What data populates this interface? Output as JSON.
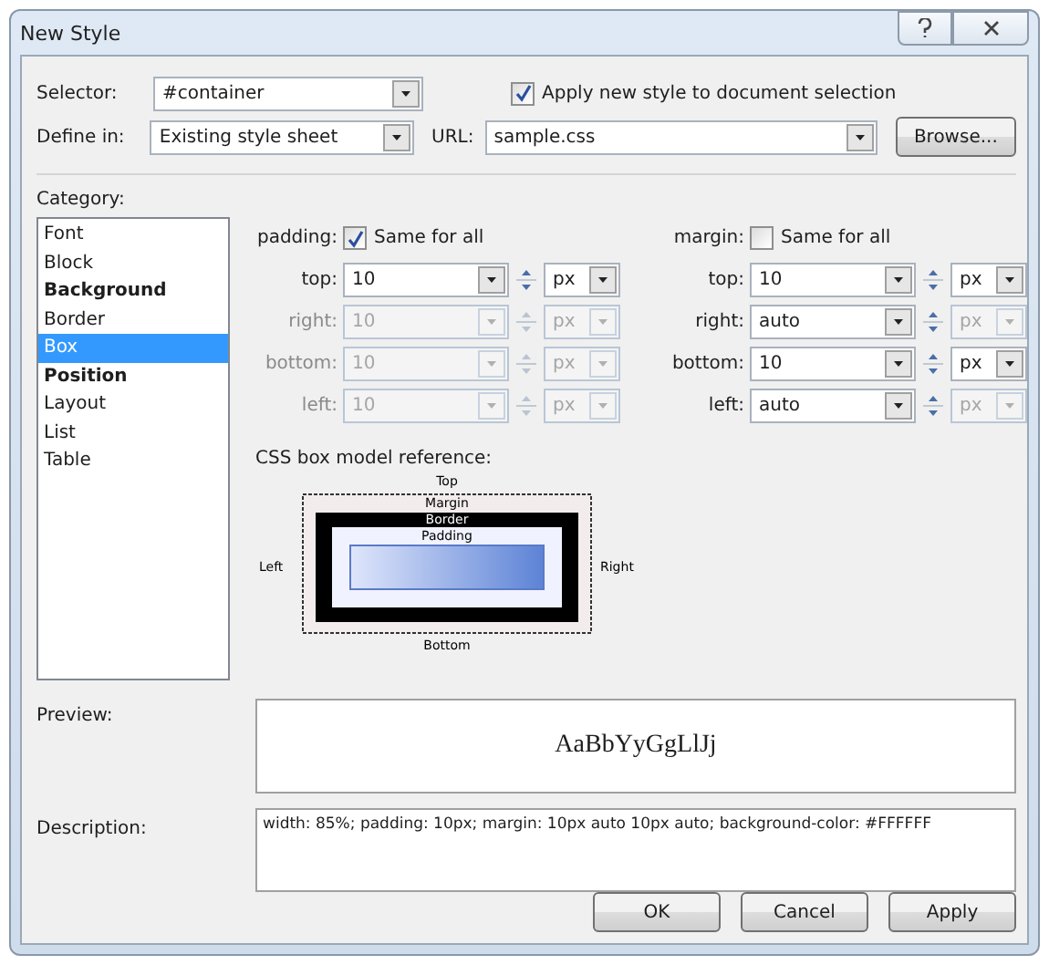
{
  "window": {
    "title": "New Style"
  },
  "selector": {
    "label": "Selector:",
    "value": "#container"
  },
  "apply_to_selection": {
    "label": "Apply new style to document selection",
    "checked": true
  },
  "define_in": {
    "label": "Define in:",
    "value": "Existing style sheet"
  },
  "url": {
    "label": "URL:",
    "value": "sample.css"
  },
  "browse_button": "Browse...",
  "category": {
    "label": "Category:",
    "items": [
      {
        "label": "Font",
        "bold": false,
        "selected": false
      },
      {
        "label": "Block",
        "bold": false,
        "selected": false
      },
      {
        "label": "Background",
        "bold": true,
        "selected": false
      },
      {
        "label": "Border",
        "bold": false,
        "selected": false
      },
      {
        "label": "Box",
        "bold": false,
        "selected": true
      },
      {
        "label": "Position",
        "bold": true,
        "selected": false
      },
      {
        "label": "Layout",
        "bold": false,
        "selected": false
      },
      {
        "label": "List",
        "bold": false,
        "selected": false
      },
      {
        "label": "Table",
        "bold": false,
        "selected": false
      }
    ]
  },
  "padding": {
    "label": "padding:",
    "same_for_all": {
      "label": "Same for all",
      "checked": true
    },
    "rows": [
      {
        "label": "top:",
        "value": "10",
        "unit": "px",
        "disabled": false,
        "unit_disabled": false
      },
      {
        "label": "right:",
        "value": "10",
        "unit": "px",
        "disabled": true,
        "unit_disabled": true
      },
      {
        "label": "bottom:",
        "value": "10",
        "unit": "px",
        "disabled": true,
        "unit_disabled": true
      },
      {
        "label": "left:",
        "value": "10",
        "unit": "px",
        "disabled": true,
        "unit_disabled": true
      }
    ]
  },
  "margin": {
    "label": "margin:",
    "same_for_all": {
      "label": "Same for all",
      "checked": false
    },
    "rows": [
      {
        "label": "top:",
        "value": "10",
        "unit": "px",
        "disabled": false,
        "unit_disabled": false
      },
      {
        "label": "right:",
        "value": "auto",
        "unit": "px",
        "disabled": false,
        "unit_disabled": true
      },
      {
        "label": "bottom:",
        "value": "10",
        "unit": "px",
        "disabled": false,
        "unit_disabled": false
      },
      {
        "label": "left:",
        "value": "auto",
        "unit": "px",
        "disabled": false,
        "unit_disabled": true
      }
    ]
  },
  "box_model": {
    "label": "CSS box model reference:",
    "top": "Top",
    "margin": "Margin",
    "border": "Border",
    "padding": "Padding",
    "left": "Left",
    "right": "Right",
    "bottom": "Bottom"
  },
  "preview": {
    "label": "Preview:",
    "sample": "AaBbYyGgLlJj"
  },
  "description": {
    "label": "Description:",
    "text": "width: 85%; padding: 10px; margin: 10px auto 10px auto; background-color: #FFFFFF"
  },
  "buttons": [
    "OK",
    "Cancel",
    "Apply"
  ]
}
